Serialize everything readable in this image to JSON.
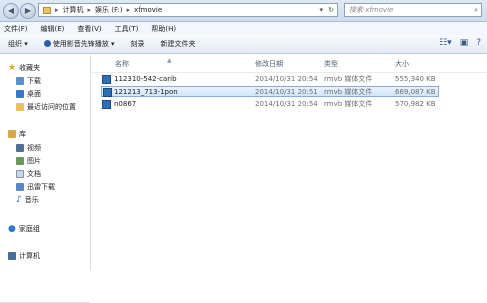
{
  "address": {
    "crumbs": [
      "计算机",
      "娱乐 (F:)",
      "xfmovie"
    ],
    "search_placeholder": "搜索 xfmovie"
  },
  "menu": [
    "文件(F)",
    "编辑(E)",
    "查看(V)",
    "工具(T)",
    "帮助(H)"
  ],
  "toolbar": {
    "organize": "组织 ▾",
    "play": "使用影音先锋播放 ▾",
    "burn": "刻录",
    "new_folder": "新建文件夹"
  },
  "sidebar": {
    "favorites": "收藏夹",
    "downloads": "下载",
    "desktop": "桌面",
    "recent": "最近访问的位置",
    "library": "库",
    "video": "视频",
    "pictures": "图片",
    "documents": "文档",
    "thunder": "迅雷下载",
    "music": "音乐",
    "homegroup": "家庭组",
    "computer": "计算机"
  },
  "columns": {
    "name": "名称",
    "date": "修改日期",
    "type": "类型",
    "size": "大小"
  },
  "files": [
    {
      "name": "112310-542-carib",
      "date": "2014/10/31 20:54",
      "type": "rmvb 媒体文件",
      "size": "555,340 KB"
    },
    {
      "name": "121213_713-1pon",
      "date": "2014/10/31 20:51",
      "type": "rmvb 媒体文件",
      "size": "669,087 KB"
    },
    {
      "name": "n0867",
      "date": "2014/10/31 20:54",
      "type": "rmvb 媒体文件",
      "size": "570,982 KB"
    }
  ]
}
